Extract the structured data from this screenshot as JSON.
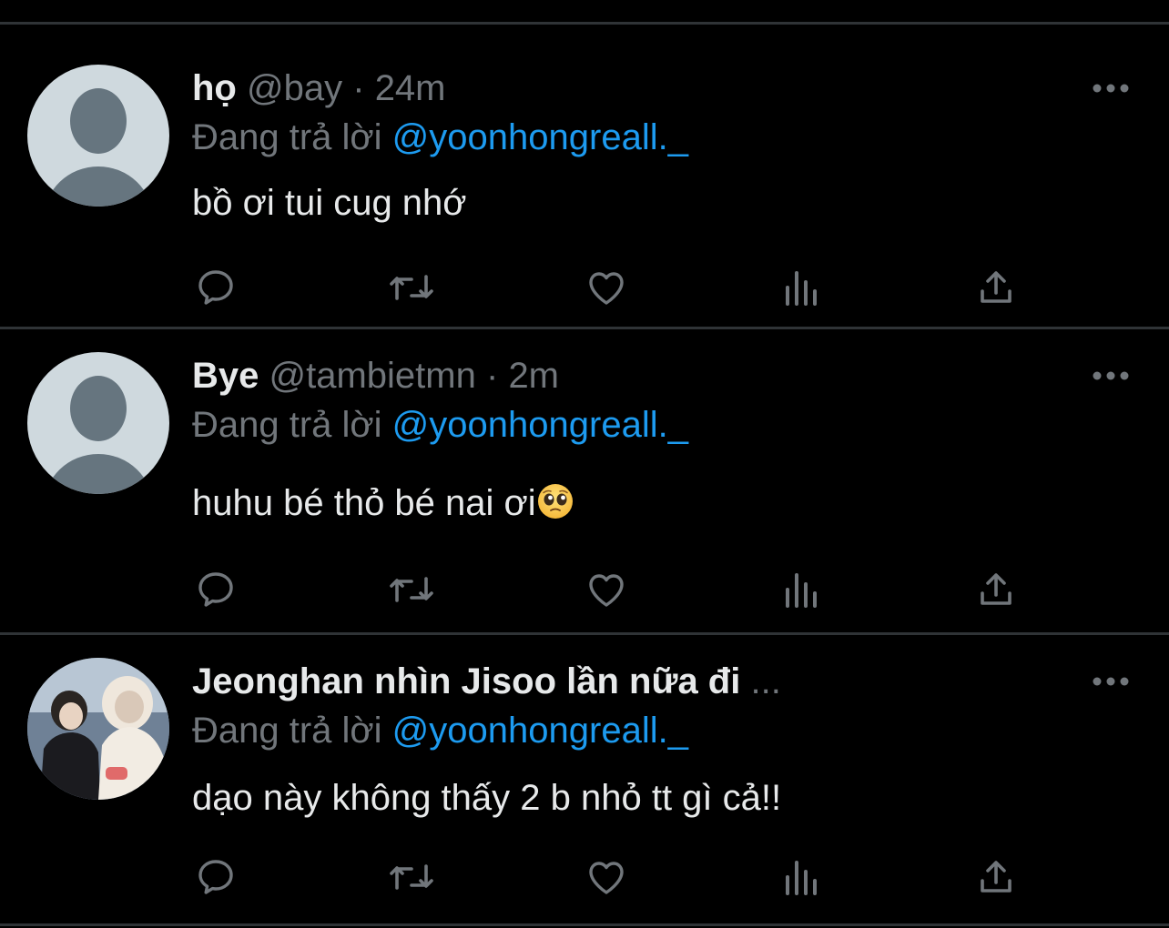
{
  "colors": {
    "background": "#000000",
    "divider": "#2f3336",
    "text_primary": "#e7e9ea",
    "text_secondary": "#71767b",
    "link": "#1d9bf0"
  },
  "tweets": [
    {
      "name": "họ",
      "handle": "@bay",
      "separator": "·",
      "time": "24m",
      "replying_prefix": "Đang trả lời",
      "replying_to": "@yoonhongreall._",
      "text": "bồ ơi tui cug nhớ",
      "avatar": "default-avatar",
      "actions": [
        "reply-icon",
        "retweet-icon",
        "like-icon",
        "analytics-icon",
        "share-icon"
      ]
    },
    {
      "name": "Bye",
      "handle": "@tambietmn",
      "separator": "·",
      "time": "2m",
      "replying_prefix": "Đang trả lời",
      "replying_to": "@yoonhongreall._",
      "text": "huhu bé thỏ bé nai ơi",
      "emoji": "pleading-face-emoji",
      "avatar": "default-avatar",
      "actions": [
        "reply-icon",
        "retweet-icon",
        "like-icon",
        "analytics-icon",
        "share-icon"
      ]
    },
    {
      "name": "Jeonghan nhìn Jisoo lần nữa đi",
      "name_truncation": "...",
      "replying_prefix": "Đang trả lời",
      "replying_to": "@yoonhongreall._",
      "text": "dạo này không thấy 2 b nhỏ tt gì cả!!",
      "avatar": "photo-avatar",
      "actions": [
        "reply-icon",
        "retweet-icon",
        "like-icon",
        "analytics-icon",
        "share-icon"
      ]
    }
  ]
}
